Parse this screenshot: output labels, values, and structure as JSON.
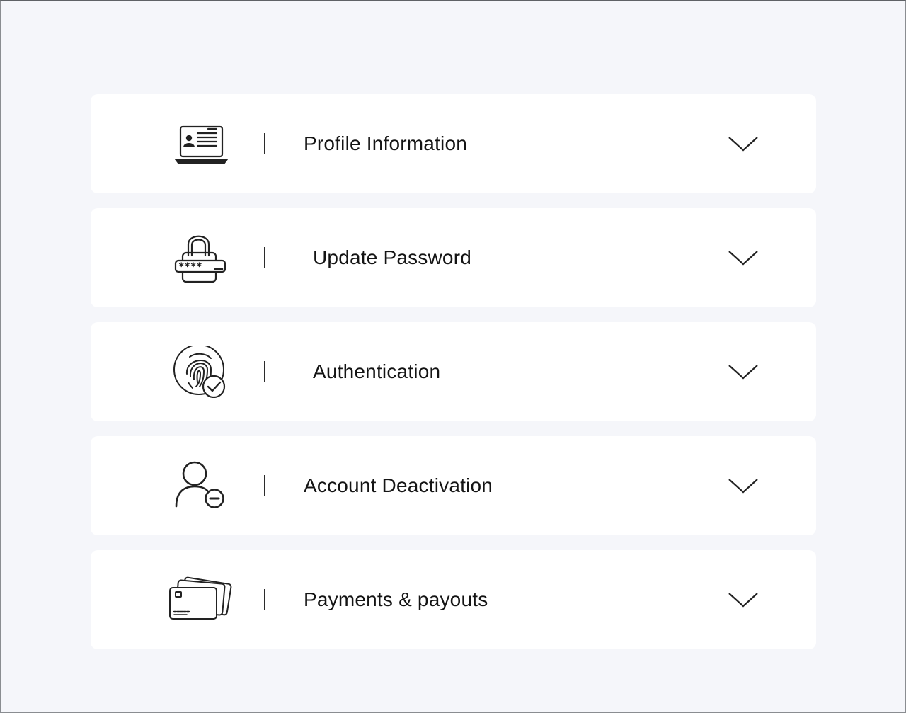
{
  "settings": {
    "items": [
      {
        "label": "Profile Information",
        "icon": "profile-card-icon"
      },
      {
        "label": "Update Password",
        "icon": "password-lock-icon"
      },
      {
        "label": "Authentication",
        "icon": "fingerprint-check-icon"
      },
      {
        "label": "Account Deactivation",
        "icon": "user-remove-icon"
      },
      {
        "label": "Payments & payouts",
        "icon": "credit-cards-icon"
      }
    ],
    "separator": "|",
    "expand_icon": "chevron-down-icon"
  }
}
